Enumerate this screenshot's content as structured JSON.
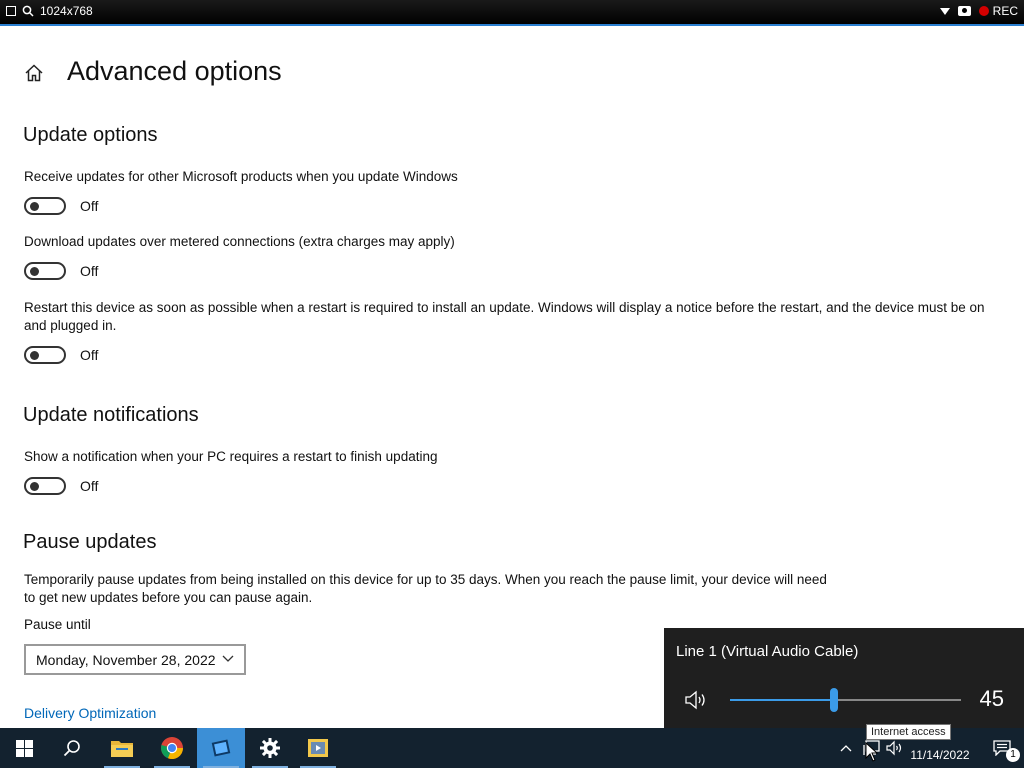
{
  "topbar": {
    "resolution": "1024x768",
    "rec_label": "REC"
  },
  "page": {
    "title": "Advanced options"
  },
  "update_options": {
    "heading": "Update options",
    "items": [
      {
        "label": "Receive updates for other Microsoft products when you update Windows",
        "state": "Off"
      },
      {
        "label": "Download updates over metered connections (extra charges may apply)",
        "state": "Off"
      },
      {
        "label": "Restart this device as soon as possible when a restart is required to install an update. Windows will display a notice before the restart, and the device must be on and plugged in.",
        "state": "Off"
      }
    ]
  },
  "notifications": {
    "heading": "Update notifications",
    "items": [
      {
        "label": "Show a notification when your PC requires a restart to finish updating",
        "state": "Off"
      }
    ]
  },
  "pause": {
    "heading": "Pause updates",
    "description": "Temporarily pause updates from being installed on this device for up to 35 days. When you reach the pause limit, your device will need to get new updates before you can pause again.",
    "until_label": "Pause until",
    "selected_date": "Monday, November 28, 2022"
  },
  "link": {
    "delivery_optimization": "Delivery Optimization"
  },
  "volume_flyout": {
    "device": "Line 1 (Virtual Audio Cable)",
    "level": 45,
    "level_text": "45"
  },
  "taskbar": {
    "tooltip": "Internet access",
    "date": "11/14/2022",
    "notification_count": "1",
    "apps": [
      "start",
      "search",
      "file-explorer",
      "chrome",
      "active-app",
      "settings",
      "media-app"
    ]
  },
  "colors": {
    "accent": "#0067b8",
    "taskbar": "#13222f",
    "slider": "#3b9be8",
    "rec": "#d40000"
  }
}
